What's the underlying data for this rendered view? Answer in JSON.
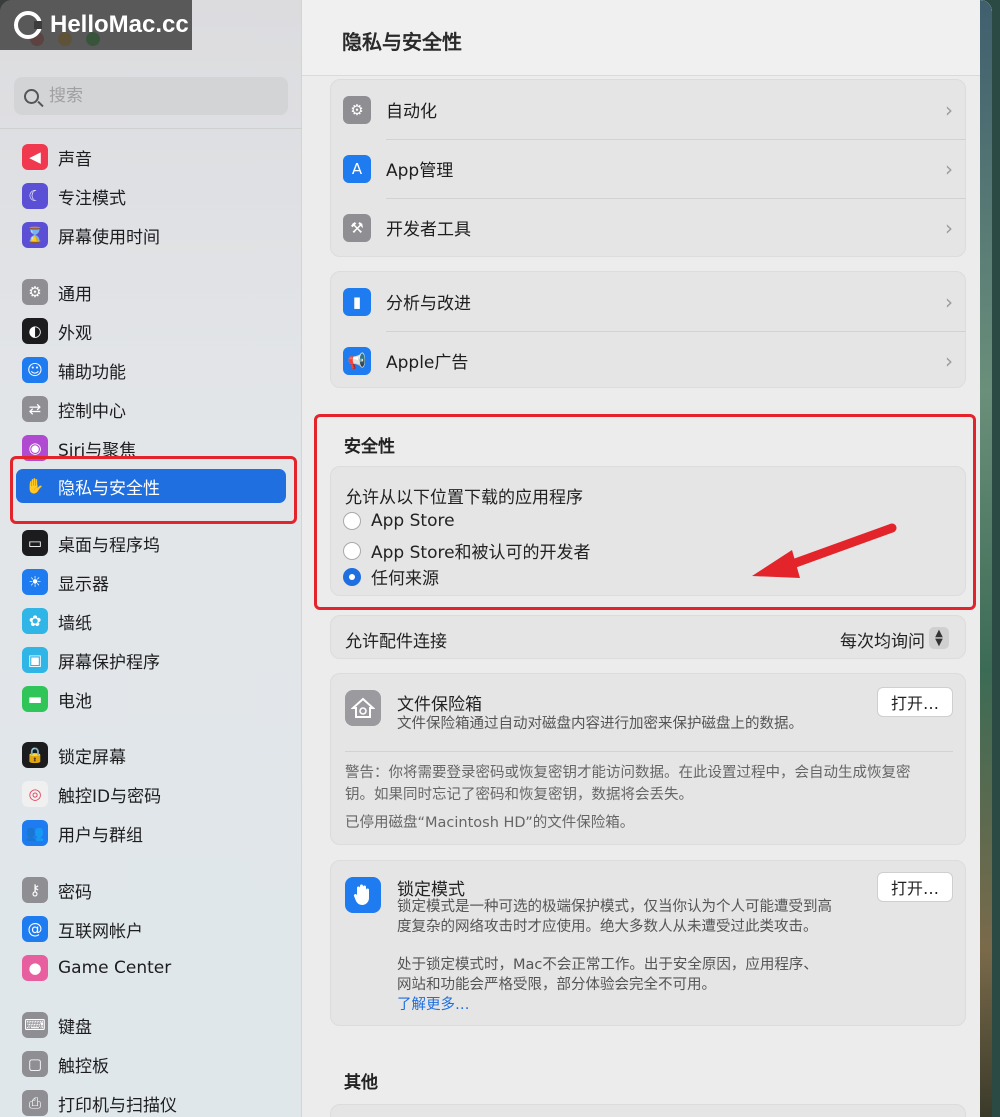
{
  "watermark": "HelloMac.cc",
  "window": {
    "traffic_colors": [
      "#ee5f56",
      "#f6bd2e",
      "#27c83f"
    ]
  },
  "sidebar": {
    "search_placeholder": "搜索",
    "items": [
      {
        "label": "声音",
        "icon": "speaker-icon",
        "color": "#f0384e"
      },
      {
        "label": "专注模式",
        "icon": "moon-icon",
        "color": "#5b4fd6"
      },
      {
        "label": "屏幕使用时间",
        "icon": "hourglass-icon",
        "color": "#5b4fd6"
      },
      {
        "label": "通用",
        "icon": "gear-icon",
        "color": "#8e8e93"
      },
      {
        "label": "外观",
        "icon": "appearance-icon",
        "color": "#1c1c1e"
      },
      {
        "label": "辅助功能",
        "icon": "accessibility-icon",
        "color": "#1f7cf0"
      },
      {
        "label": "控制中心",
        "icon": "toggle-icon",
        "color": "#8e8e93"
      },
      {
        "label": "Siri与聚焦",
        "icon": "siri-icon",
        "color": "#b04ad0"
      },
      {
        "label": "隐私与安全性",
        "icon": "hand-icon",
        "color": "#1f6fe0"
      },
      {
        "label": "桌面与程序坞",
        "icon": "dock-icon",
        "color": "#1c1c1e"
      },
      {
        "label": "显示器",
        "icon": "sun-icon",
        "color": "#1f7cf0"
      },
      {
        "label": "墙纸",
        "icon": "flower-icon",
        "color": "#2fb5e6"
      },
      {
        "label": "屏幕保护程序",
        "icon": "screensaver-icon",
        "color": "#2fb5e6"
      },
      {
        "label": "电池",
        "icon": "battery-icon",
        "color": "#30c559"
      },
      {
        "label": "锁定屏幕",
        "icon": "lock-icon",
        "color": "#1c1c1e"
      },
      {
        "label": "触控ID与密码",
        "icon": "fingerprint-icon",
        "color": "#f0f0f0"
      },
      {
        "label": "用户与群组",
        "icon": "users-icon",
        "color": "#1f7cf0"
      },
      {
        "label": "密码",
        "icon": "key-icon",
        "color": "#8e8e93"
      },
      {
        "label": "互联网帐户",
        "icon": "at-icon",
        "color": "#1f7cf0"
      },
      {
        "label": "Game Center",
        "icon": "game-center-icon",
        "color": "#e85fa0"
      },
      {
        "label": "键盘",
        "icon": "keyboard-icon",
        "color": "#8e8e93"
      },
      {
        "label": "触控板",
        "icon": "trackpad-icon",
        "color": "#8e8e93"
      },
      {
        "label": "打印机与扫描仪",
        "icon": "printer-icon",
        "color": "#8e8e93"
      }
    ]
  },
  "main": {
    "title": "隐私与安全性",
    "group1": [
      {
        "label": "自动化",
        "icon": "gears-icon",
        "color": "#8e8e93"
      },
      {
        "label": "App管理",
        "icon": "app-store-icon",
        "color": "#1f7cf0"
      },
      {
        "label": "开发者工具",
        "icon": "hammer-icon",
        "color": "#8e8e93"
      }
    ],
    "group2": [
      {
        "label": "分析与改进",
        "icon": "chart-icon",
        "color": "#1f7cf0"
      },
      {
        "label": "Apple广告",
        "icon": "megaphone-icon",
        "color": "#1f7cf0"
      }
    ],
    "security": {
      "title": "安全性",
      "description": "允许从以下位置下载的应用程序",
      "options": [
        "App Store",
        "App Store和被认可的开发者",
        "任何来源"
      ],
      "selected": "任何来源"
    },
    "accessories": {
      "label": "允许配件连接",
      "value": "每次均询问"
    },
    "filevault": {
      "title": "文件保险箱",
      "description": "文件保险箱通过自动对磁盘内容进行加密来保护磁盘上的数据。",
      "button": "打开…",
      "warning_line1": "警告：你将需要登录密码或恢复密钥才能访问数据。在此设置过程中，会自动生成恢复密",
      "warning_line2": "钥。如果同时忘记了密码和恢复密钥，数据将会丢失。",
      "status": "已停用磁盘“Macintosh HD”的文件保险箱。"
    },
    "lockdown": {
      "title": "锁定模式",
      "desc_line1": "锁定模式是一种可选的极端保护模式，仅当你认为个人可能遭受到高",
      "desc_line2": "度复杂的网络攻击时才应使用。绝大多数人从未遭受过此类攻击。",
      "desc_line3": "处于锁定模式时，Mac不会正常工作。出于安全原因，应用程序、",
      "desc_line4": "网站和功能会严格受限，部分体验会完全不可用。",
      "learn_more": "了解更多…",
      "button": "打开…"
    },
    "other_title": "其他"
  }
}
